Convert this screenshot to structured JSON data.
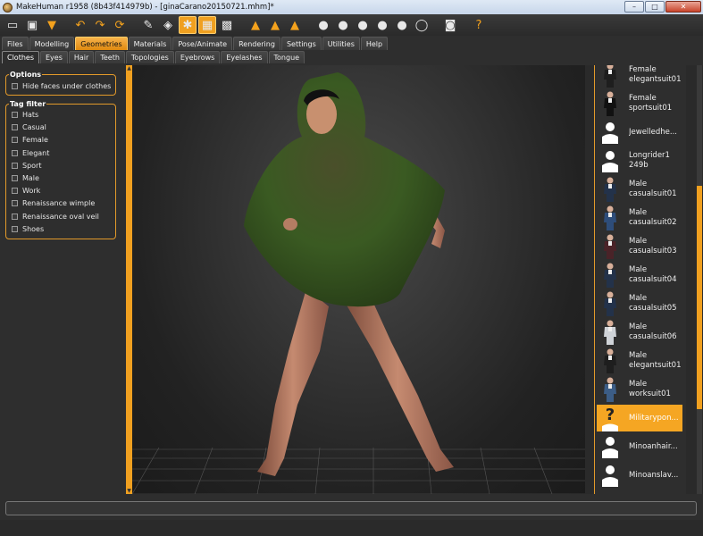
{
  "window": {
    "title": "MakeHuman r1958 (8b43f414979b) - [ginaCarano20150721.mhm]*",
    "controls": {
      "minimize": "–",
      "maximize": "□",
      "close": "✕"
    }
  },
  "toolbar": {
    "buttons": [
      {
        "name": "toggle-subdivision-icon",
        "glyph": "▭"
      },
      {
        "name": "save-icon",
        "glyph": "▣"
      },
      {
        "name": "export-icon",
        "glyph": "▼"
      },
      {
        "name": "undo-icon",
        "glyph": "↶"
      },
      {
        "name": "redo-icon",
        "glyph": "↷"
      },
      {
        "name": "reset-icon",
        "glyph": "⟳"
      },
      {
        "name": "smooth-icon",
        "glyph": "✎"
      },
      {
        "name": "wireframe-icon",
        "glyph": "◈"
      },
      {
        "name": "pose-icon",
        "glyph": "✱"
      },
      {
        "name": "grid-icon",
        "glyph": "▦"
      },
      {
        "name": "background-icon",
        "glyph": "▩"
      },
      {
        "name": "front-view-icon",
        "glyph": "▲"
      },
      {
        "name": "back-view-icon",
        "glyph": "▲"
      },
      {
        "name": "side-view-icon",
        "glyph": "▲"
      },
      {
        "name": "head-front-icon",
        "glyph": "●"
      },
      {
        "name": "head-back-icon",
        "glyph": "●"
      },
      {
        "name": "head-left-icon",
        "glyph": "●"
      },
      {
        "name": "head-right-icon",
        "glyph": "●"
      },
      {
        "name": "head-top-icon",
        "glyph": "●"
      },
      {
        "name": "reset-camera-icon",
        "glyph": "◯"
      },
      {
        "name": "screenshot-icon",
        "glyph": "◙"
      },
      {
        "name": "help-icon",
        "glyph": "?"
      }
    ]
  },
  "main_tabs": [
    "Files",
    "Modelling",
    "Geometries",
    "Materials",
    "Pose/Animate",
    "Rendering",
    "Settings",
    "Utilities",
    "Help"
  ],
  "main_tab_selected": "Geometries",
  "sub_tabs": [
    "Clothes",
    "Eyes",
    "Hair",
    "Teeth",
    "Topologies",
    "Eyebrows",
    "Eyelashes",
    "Tongue"
  ],
  "sub_tab_selected": "Clothes",
  "options": {
    "title": "Options",
    "items": [
      "Hide faces under clothes"
    ]
  },
  "tag_filter": {
    "title": "Tag filter",
    "items": [
      "Hats",
      "Casual",
      "Female",
      "Elegant",
      "Sport",
      "Male",
      "Work",
      "Renaissance wimple",
      "Renaissance oval veil",
      "Shoes"
    ]
  },
  "clothes_list": [
    {
      "label": "Female\nelegantsuit01",
      "thumb": "suit-dark"
    },
    {
      "label": "Female\nsportsuit01",
      "thumb": "suit-sport"
    },
    {
      "label": "Jewelledhe...",
      "thumb": "placeholder"
    },
    {
      "label": "Longrider1\n249b",
      "thumb": "placeholder"
    },
    {
      "label": "Male\ncasualsuit01",
      "thumb": "suit-navy"
    },
    {
      "label": "Male\ncasualsuit02",
      "thumb": "suit-blue"
    },
    {
      "label": "Male\ncasualsuit03",
      "thumb": "suit-maroon"
    },
    {
      "label": "Male\ncasualsuit04",
      "thumb": "suit-navy"
    },
    {
      "label": "Male\ncasualsuit05",
      "thumb": "suit-navy"
    },
    {
      "label": "Male\ncasualsuit06",
      "thumb": "suit-white"
    },
    {
      "label": "Male\nelegantsuit01",
      "thumb": "suit-dark"
    },
    {
      "label": "Male\nworksuit01",
      "thumb": "suit-work"
    },
    {
      "label": "Militarypon...",
      "thumb": "question",
      "selected": true
    },
    {
      "label": "Minoanhair...",
      "thumb": "placeholder"
    },
    {
      "label": "Minoanslav...",
      "thumb": "placeholder"
    }
  ],
  "colors": {
    "accent": "#f0a020",
    "panel_bg": "#2e2e2e",
    "selected_item": "#f5a623"
  }
}
